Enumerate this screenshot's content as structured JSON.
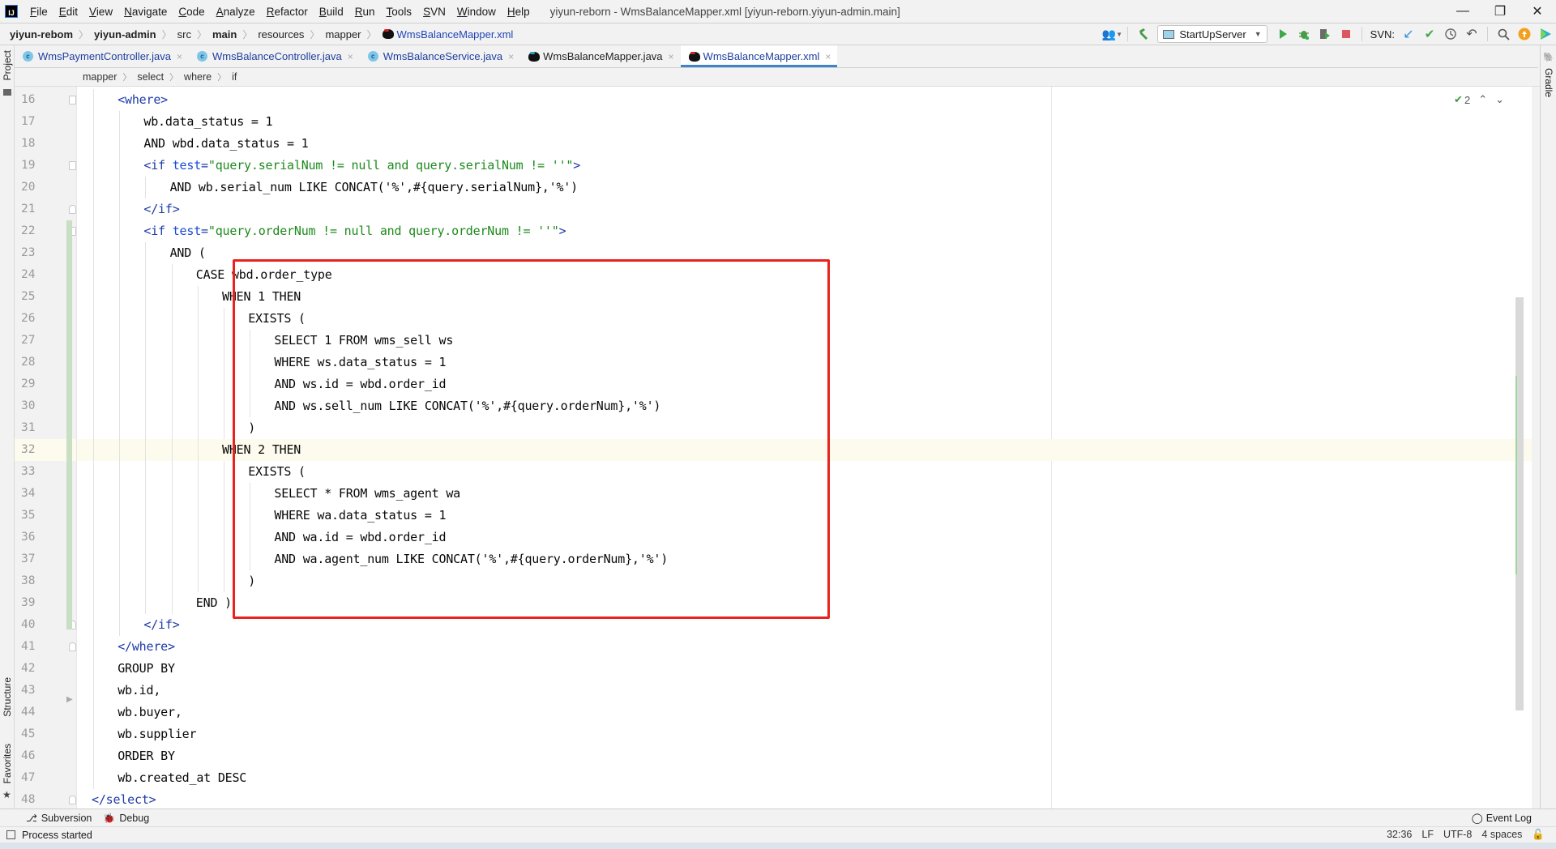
{
  "window": {
    "title": "yiyun-reborn - WmsBalanceMapper.xml [yiyun-reborn.yiyun-admin.main]",
    "logo": "IJ",
    "controls": {
      "minimize": "—",
      "maximize": "❐",
      "close": "✕"
    }
  },
  "menu": [
    {
      "label": "File"
    },
    {
      "label": "Edit"
    },
    {
      "label": "View"
    },
    {
      "label": "Navigate"
    },
    {
      "label": "Code"
    },
    {
      "label": "Analyze"
    },
    {
      "label": "Refactor"
    },
    {
      "label": "Build"
    },
    {
      "label": "Run"
    },
    {
      "label": "Tools"
    },
    {
      "label": "SVN"
    },
    {
      "label": "Window"
    },
    {
      "label": "Help"
    }
  ],
  "nav_breadcrumb": [
    {
      "label": "yiyun-rebom",
      "bold": true
    },
    {
      "label": "yiyun-admin",
      "bold": true
    },
    {
      "label": "src"
    },
    {
      "label": "main",
      "bold": true
    },
    {
      "label": "resources"
    },
    {
      "label": "mapper"
    },
    {
      "label": "WmsBalanceMapper.xml",
      "icon": "mybatis-icon"
    }
  ],
  "toolbar": {
    "run_config": "StartUpServer",
    "svn_label": "SVN:",
    "icons": [
      "user-icon",
      "build-hammer-icon",
      "run-icon",
      "debug-icon",
      "coverage-icon",
      "stop-icon",
      "svn-update-icon",
      "svn-commit-icon",
      "history-icon",
      "revert-icon",
      "search-icon",
      "update-available-icon",
      "plugin-icon"
    ]
  },
  "tabs": [
    {
      "label": "WmsPaymentController.java",
      "icon": "class-icon",
      "active": false
    },
    {
      "label": "WmsBalanceController.java",
      "icon": "class-icon",
      "active": false
    },
    {
      "label": "WmsBalanceService.java",
      "icon": "class-icon",
      "active": false
    },
    {
      "label": "WmsBalanceMapper.java",
      "icon": "mybatis-icon",
      "active": false
    },
    {
      "label": "WmsBalanceMapper.xml",
      "icon": "mybatis-icon",
      "active": true
    }
  ],
  "tab_close_glyph": "×",
  "side_panels": {
    "left_top": "Project",
    "left_middle": "Structure",
    "left_bottom": "Favorites",
    "right_top": "Gradle"
  },
  "editor_breadcrumb": [
    "mapper",
    "select",
    "where",
    "if"
  ],
  "inspection": {
    "count": "2",
    "icon": "inspection-ok-icon"
  },
  "code_lines": [
    {
      "n": "16",
      "indent": 2,
      "parts": [
        [
          "tag",
          "<where>"
        ]
      ]
    },
    {
      "n": "17",
      "indent": 3,
      "parts": [
        [
          "",
          "wb.data_status = 1"
        ]
      ]
    },
    {
      "n": "18",
      "indent": 3,
      "parts": [
        [
          "",
          "AND wbd.data_status = 1"
        ]
      ]
    },
    {
      "n": "19",
      "indent": 3,
      "parts": [
        [
          "tag",
          "<if "
        ],
        [
          "attr",
          "test"
        ],
        [
          "tag",
          "="
        ],
        [
          "str",
          "\"query.serialNum != null and query.serialNum != ''\""
        ],
        [
          "tag",
          ">"
        ]
      ]
    },
    {
      "n": "20",
      "indent": 4,
      "parts": [
        [
          "",
          "AND wb.serial_num LIKE CONCAT('%',#{query.serialNum},'%')"
        ]
      ]
    },
    {
      "n": "21",
      "indent": 3,
      "parts": [
        [
          "tag",
          "</if>"
        ]
      ]
    },
    {
      "n": "22",
      "indent": 3,
      "parts": [
        [
          "tag",
          "<if "
        ],
        [
          "attr",
          "test"
        ],
        [
          "tag",
          "="
        ],
        [
          "str",
          "\"query.orderNum != null and query.orderNum != ''\""
        ],
        [
          "tag",
          ">"
        ]
      ]
    },
    {
      "n": "23",
      "indent": 4,
      "parts": [
        [
          "",
          "AND ("
        ]
      ]
    },
    {
      "n": "24",
      "indent": 5,
      "parts": [
        [
          "",
          "CASE wbd.order_type"
        ]
      ]
    },
    {
      "n": "25",
      "indent": 6,
      "parts": [
        [
          "",
          "WHEN 1 THEN"
        ]
      ]
    },
    {
      "n": "26",
      "indent": 7,
      "parts": [
        [
          "",
          "EXISTS ("
        ]
      ]
    },
    {
      "n": "27",
      "indent": 8,
      "parts": [
        [
          "",
          "SELECT 1 FROM wms_sell ws"
        ]
      ]
    },
    {
      "n": "28",
      "indent": 8,
      "parts": [
        [
          "",
          "WHERE ws.data_status = 1"
        ]
      ]
    },
    {
      "n": "29",
      "indent": 8,
      "parts": [
        [
          "",
          "AND ws.id = wbd.order_id"
        ]
      ]
    },
    {
      "n": "30",
      "indent": 8,
      "parts": [
        [
          "",
          "AND ws.sell_num LIKE CONCAT('%',#{query.orderNum},'%')"
        ]
      ]
    },
    {
      "n": "31",
      "indent": 7,
      "parts": [
        [
          "",
          ")"
        ]
      ]
    },
    {
      "n": "32",
      "indent": 6,
      "parts": [
        [
          "",
          "WHEN 2 THEN"
        ]
      ]
    },
    {
      "n": "33",
      "indent": 7,
      "parts": [
        [
          "",
          "EXISTS ("
        ]
      ]
    },
    {
      "n": "34",
      "indent": 8,
      "parts": [
        [
          "",
          "SELECT * FROM wms_agent wa"
        ]
      ]
    },
    {
      "n": "35",
      "indent": 8,
      "parts": [
        [
          "",
          "WHERE wa.data_status = 1"
        ]
      ]
    },
    {
      "n": "36",
      "indent": 8,
      "parts": [
        [
          "",
          "AND wa.id = wbd.order_id"
        ]
      ]
    },
    {
      "n": "37",
      "indent": 8,
      "parts": [
        [
          "",
          "AND wa.agent_num LIKE CONCAT('%',#{query.orderNum},'%')"
        ]
      ]
    },
    {
      "n": "38",
      "indent": 7,
      "parts": [
        [
          "",
          ")"
        ]
      ]
    },
    {
      "n": "39",
      "indent": 5,
      "parts": [
        [
          "",
          "END )"
        ]
      ]
    },
    {
      "n": "40",
      "indent": 3,
      "parts": [
        [
          "tag",
          "</if>"
        ]
      ]
    },
    {
      "n": "41",
      "indent": 2,
      "parts": [
        [
          "tag",
          "</where>"
        ]
      ]
    },
    {
      "n": "42",
      "indent": 2,
      "parts": [
        [
          "",
          "GROUP BY"
        ]
      ]
    },
    {
      "n": "43",
      "indent": 2,
      "parts": [
        [
          "",
          "wb.id,"
        ]
      ]
    },
    {
      "n": "44",
      "indent": 2,
      "parts": [
        [
          "",
          "wb.buyer,"
        ]
      ]
    },
    {
      "n": "45",
      "indent": 2,
      "parts": [
        [
          "",
          "wb.supplier"
        ]
      ]
    },
    {
      "n": "46",
      "indent": 2,
      "parts": [
        [
          "",
          "ORDER BY"
        ]
      ]
    },
    {
      "n": "47",
      "indent": 2,
      "parts": [
        [
          "",
          "wb.created_at DESC"
        ]
      ]
    },
    {
      "n": "48",
      "indent": 1,
      "parts": [
        [
          "tag",
          "</select>"
        ]
      ]
    }
  ],
  "caret_line": "32",
  "highlight": {
    "color": "#e8221c",
    "from_line": "24",
    "to_line": "39"
  },
  "colors": {
    "tag": "#1e3aa8",
    "attribute": "#174ad4",
    "string": "#1c8a1c",
    "active_tab_underline": "#4083c9",
    "caret_row": "#fdfbed"
  },
  "bottom_tools": [
    {
      "label": "Subversion",
      "icon": "subversion-icon"
    },
    {
      "label": "Debug",
      "icon": "debug-icon"
    }
  ],
  "event_log": "Event Log",
  "status": {
    "message": "Process started",
    "position": "32:36",
    "line_separator": "LF",
    "encoding": "UTF-8",
    "indent": "4 spaces"
  }
}
